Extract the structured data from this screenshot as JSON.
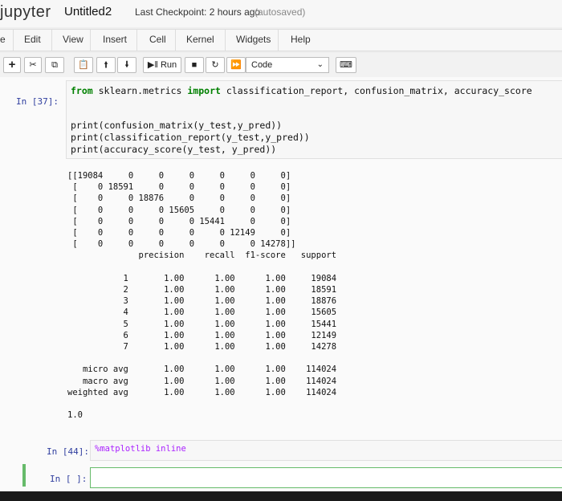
{
  "header": {
    "logo": "jupyter",
    "notebook_name": "Untitled2",
    "checkpoint": "Last Checkpoint: 2 hours ago",
    "autosaved": "(autosaved)"
  },
  "menu": {
    "file_fragment": "e",
    "items": [
      "Edit",
      "View",
      "Insert",
      "Cell",
      "Kernel",
      "Widgets",
      "Help"
    ]
  },
  "toolbar": {
    "run_label": "Run",
    "cell_type": "Code",
    "icons": [
      "plus-icon",
      "cut-icon",
      "copy-icon",
      "paste-icon",
      "arrow-up-icon",
      "arrow-down-icon",
      "run-icon",
      "stop-icon",
      "restart-icon",
      "fast-forward-icon",
      "chevron-down-icon",
      "keyboard-icon"
    ]
  },
  "cells": {
    "cell1": {
      "prompt": "In [37]:",
      "import_kw_from": "from",
      "import_module": " sklearn.metrics ",
      "import_kw_import": "import",
      "import_names": " classification_report, confusion_matrix, accuracy_score",
      "code_lines": [
        "print(confusion_matrix(y_test,y_pred))",
        "print(classification_report(y_test,y_pred))",
        "print(accuracy_score(y_test, y_pred))"
      ],
      "output_lines": [
        "[[19084     0     0     0     0     0     0]",
        " [    0 18591     0     0     0     0     0]",
        " [    0     0 18876     0     0     0     0]",
        " [    0     0     0 15605     0     0     0]",
        " [    0     0     0     0 15441     0     0]",
        " [    0     0     0     0     0 12149     0]",
        " [    0     0     0     0     0     0 14278]]",
        "              precision    recall  f1-score   support",
        "",
        "           1       1.00      1.00      1.00     19084",
        "           2       1.00      1.00      1.00     18591",
        "           3       1.00      1.00      1.00     18876",
        "           4       1.00      1.00      1.00     15605",
        "           5       1.00      1.00      1.00     15441",
        "           6       1.00      1.00      1.00     12149",
        "           7       1.00      1.00      1.00     14278",
        "",
        "   micro avg       1.00      1.00      1.00    114024",
        "   macro avg       1.00      1.00      1.00    114024",
        "weighted avg       1.00      1.00      1.00    114024",
        "",
        "1.0"
      ]
    },
    "cell2": {
      "prompt": "In [44]:",
      "code": "%matplotlib inline"
    },
    "cell3": {
      "prompt": "In [ ]:",
      "code": ""
    }
  }
}
